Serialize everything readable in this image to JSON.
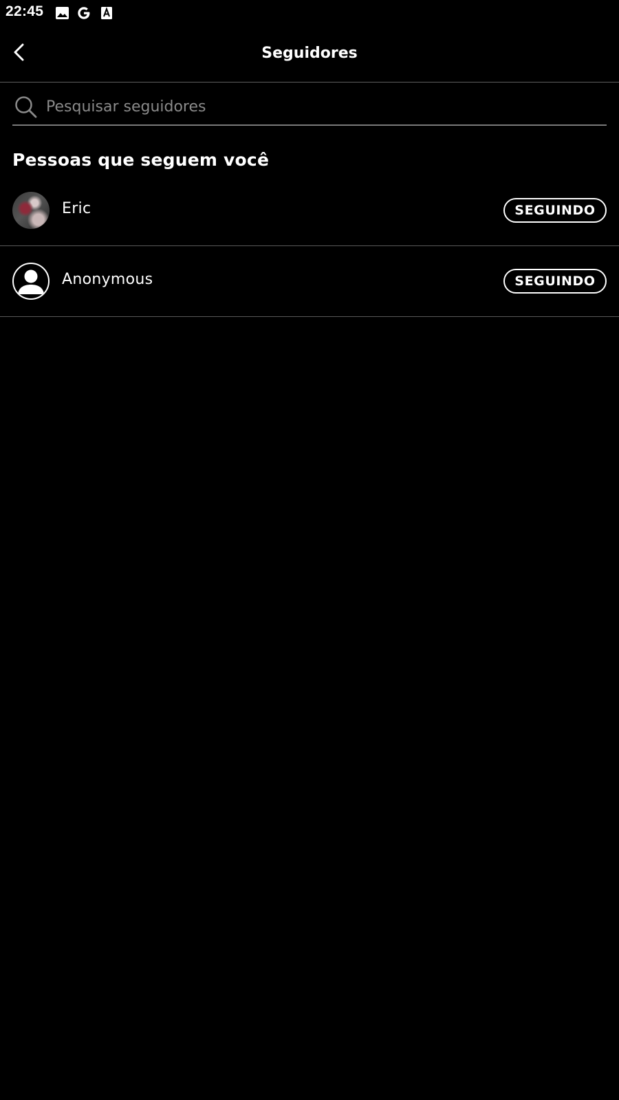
{
  "status_bar": {
    "time": "22:45",
    "icons": [
      "image-icon",
      "google-icon",
      "font-a-icon"
    ]
  },
  "header": {
    "title": "Seguidores",
    "back_icon": "chevron-left-icon"
  },
  "search": {
    "placeholder": "Pesquisar seguidores",
    "value": "",
    "icon": "search-icon"
  },
  "section": {
    "heading": "Pessoas que seguem você"
  },
  "followers": [
    {
      "name": "Eric",
      "button_label": "SEGUINDO",
      "avatar": "photo"
    },
    {
      "name": "Anonymous",
      "button_label": "SEGUINDO",
      "avatar": "default-user-icon"
    }
  ],
  "colors": {
    "background": "#000000",
    "text": "#ffffff",
    "placeholder": "#8a8a8a",
    "divider": "#5a5a5a"
  }
}
